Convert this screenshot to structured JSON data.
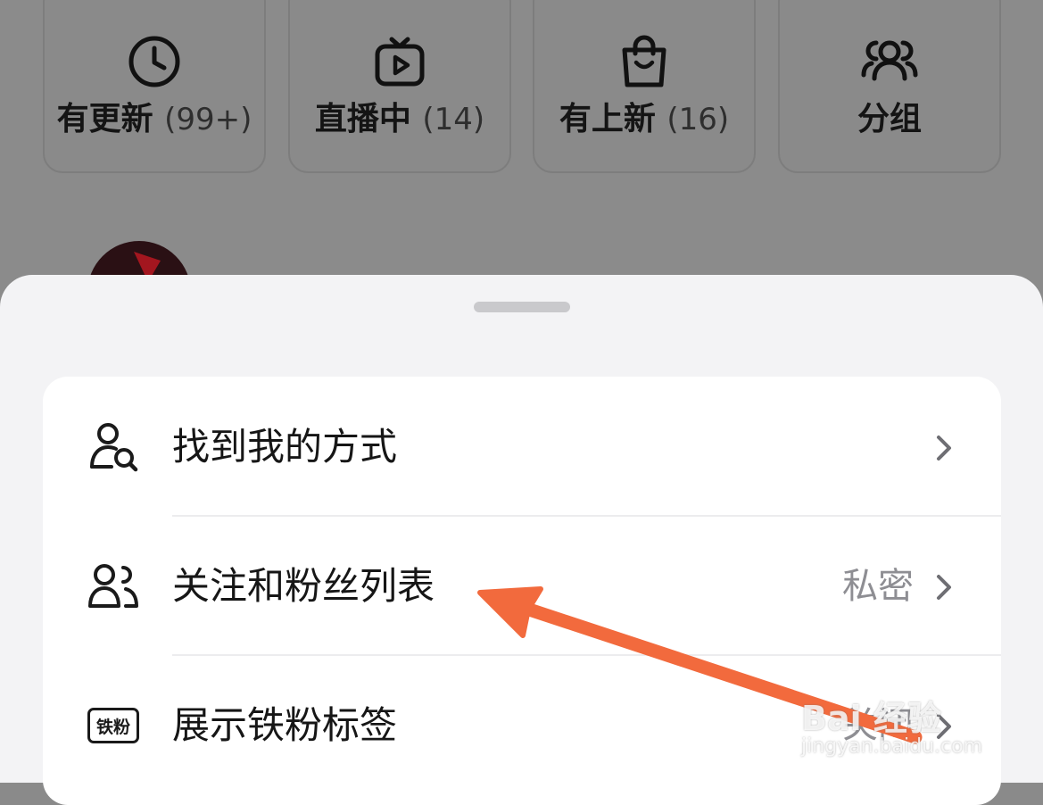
{
  "quick_tiles": [
    {
      "label": "有更新",
      "count": "(99+)",
      "icon": "clock-icon"
    },
    {
      "label": "直播中",
      "count": "(14)",
      "icon": "live-tv-icon"
    },
    {
      "label": "有上新",
      "count": "(16)",
      "icon": "shopping-bag-icon"
    },
    {
      "label": "分组",
      "count": "",
      "icon": "group-icon"
    }
  ],
  "sheet": {
    "rows": [
      {
        "label": "找到我的方式",
        "value": "",
        "icon": "find-user-icon"
      },
      {
        "label": "关注和粉丝列表",
        "value": "私密",
        "icon": "users-icon"
      },
      {
        "label": "展示铁粉标签",
        "value": "关闭",
        "icon": "fan-badge-icon",
        "icon_text": "铁粉"
      }
    ]
  },
  "watermark": {
    "main": "Bai 经验",
    "sub": "jingyan.baidu.com"
  },
  "colors": {
    "annotation_arrow": "#f26a3d",
    "sheet_background": "#f3f3f5",
    "card_background": "#ffffff",
    "overlay_dim": "#8b8b8b"
  }
}
